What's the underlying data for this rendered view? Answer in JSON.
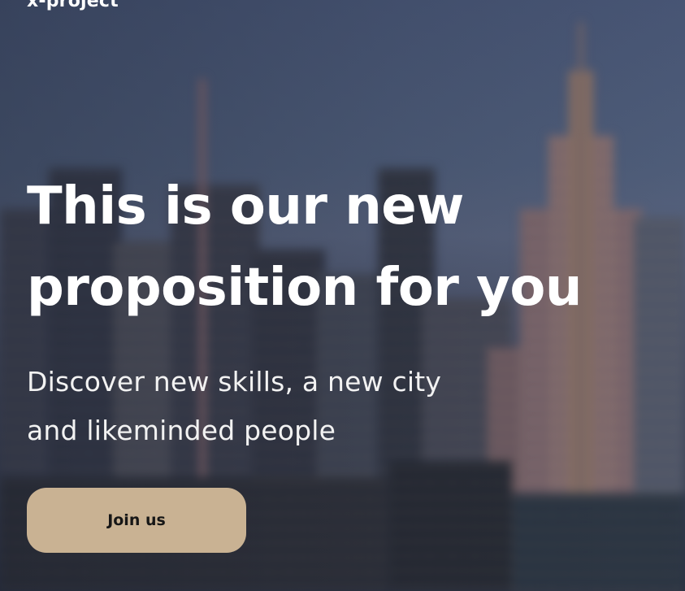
{
  "brand": {
    "logo_text": "x-project"
  },
  "hero": {
    "headline_line1": "This is our new",
    "headline_line2": "proposition for you",
    "subline_line1": "Discover new skills, a new city",
    "subline_line2": "and likeminded people",
    "cta_label": "Join us",
    "background": "blurred-city-skyline-image"
  },
  "colors": {
    "cta_background": "#c9b293",
    "cta_text": "#161616",
    "headline_text": "#ffffff"
  }
}
